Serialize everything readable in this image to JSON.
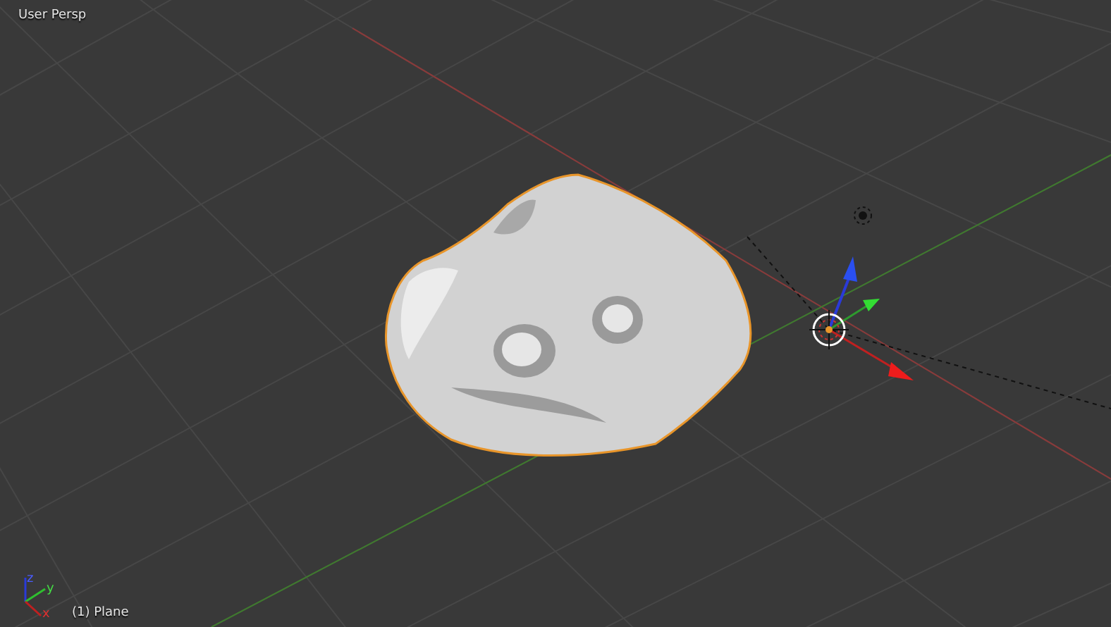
{
  "viewport": {
    "view_label": "User Persp",
    "object_label": "(1) Plane",
    "axis_labels": [
      "z",
      "y",
      "x"
    ]
  }
}
